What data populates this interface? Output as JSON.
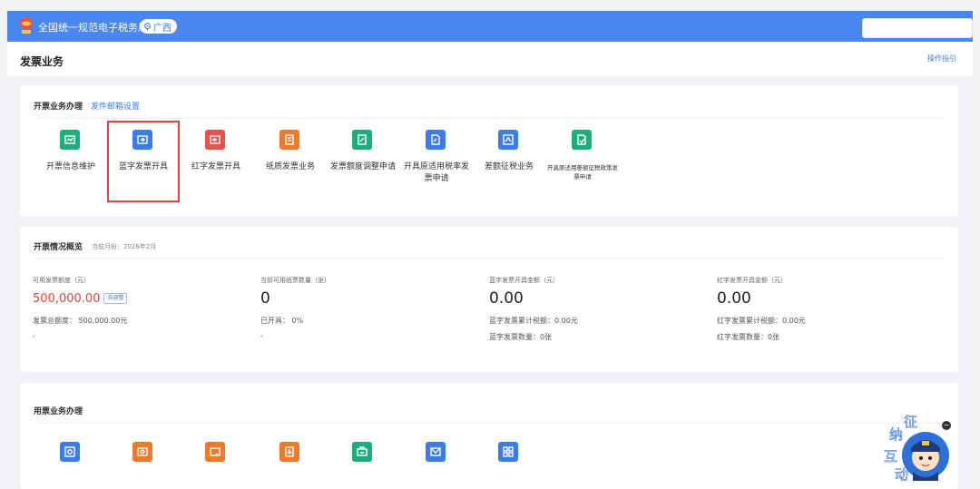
{
  "header": {
    "site_title": "全国统一规范电子税务局",
    "region": "广西"
  },
  "page": {
    "title": "发票业务",
    "guide_link": "操作指引"
  },
  "invoicing": {
    "title": "开票业务办理",
    "settings_link": "发件邮箱设置",
    "tiles": [
      {
        "label": "开票信息维护",
        "icon": "invoice-info-icon",
        "color": "#1fae7a"
      },
      {
        "label": "蓝字发票开具",
        "icon": "blue-invoice-icon",
        "color": "#3d7ce8"
      },
      {
        "label": "红字发票开具",
        "icon": "red-invoice-icon",
        "color": "#e8524a"
      },
      {
        "label": "纸质发票业务",
        "icon": "paper-invoice-icon",
        "color": "#ee7b2c"
      },
      {
        "label": "发票额度调整申请",
        "icon": "quota-adjust-icon",
        "color": "#1fae7a"
      },
      {
        "label": "开具原适用税率发票申请",
        "icon": "original-rate-icon",
        "color": "#3d7ce8"
      },
      {
        "label": "差额征税业务",
        "icon": "difference-tax-icon",
        "color": "#3d7ce8"
      },
      {
        "label": "开具原适用差额征税政策发票申请",
        "icon": "difference-policy-icon",
        "color": "#1fae7a"
      }
    ],
    "selected_index": 1
  },
  "overview": {
    "title": "开票情况概览",
    "current_month": "当前月份：2026年2月",
    "stats": [
      {
        "label": "可用发票额度（元）",
        "value": "500,000.00",
        "button": "去调整",
        "line1": "发票总额度： 500,000.00元",
        "line2": "-"
      },
      {
        "label": "当前可用纸票数量（张）",
        "value": "0",
        "line1": "已开具： 0%",
        "line2": "-"
      },
      {
        "label": "蓝字发票开具金额（元）",
        "value": "0.00",
        "line1": "蓝字发票累计税额：0.00元",
        "line2": "蓝字发票数量：0张"
      },
      {
        "label": "红字发票开具金额（元）",
        "value": "0.00",
        "line1": "红字发票累计税额：0.00元",
        "line2": "红字发票数量：0张"
      }
    ]
  },
  "usage": {
    "title": "用票业务办理",
    "tiles": [
      {
        "icon": "invoice-query-icon",
        "color": "#3d7ce8"
      },
      {
        "icon": "ticket-icon",
        "color": "#ee7b2c"
      },
      {
        "icon": "invoice-card-icon",
        "color": "#ee7b2c"
      },
      {
        "icon": "download-doc-icon",
        "color": "#ee7b2c"
      },
      {
        "icon": "print-icon",
        "color": "#1fae7a"
      },
      {
        "icon": "mail-icon",
        "color": "#3d7ce8"
      },
      {
        "icon": "grid-apps-icon",
        "color": "#3d7ce8"
      }
    ]
  },
  "assistant": {
    "text1": "纳",
    "text2": "征",
    "text3": "互",
    "text4": "动",
    "close": "−"
  }
}
